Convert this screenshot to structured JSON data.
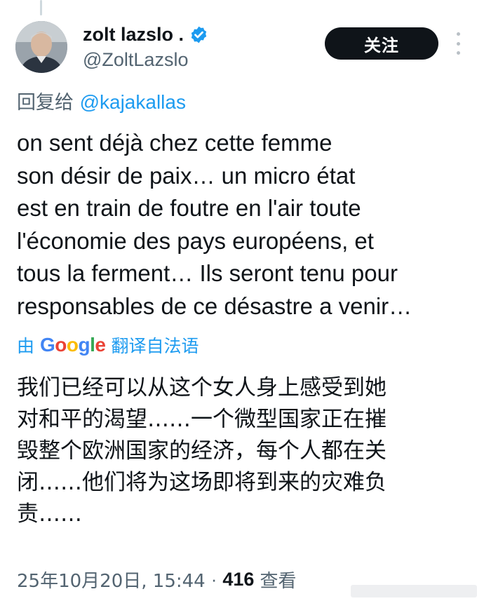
{
  "author": {
    "display_name": "zolt lazslo .",
    "handle": "@ZoltLazslo",
    "verified": true,
    "avatar": "avatar-photo"
  },
  "actions": {
    "follow_label": "关注",
    "more_icon": "more-vertical-icon"
  },
  "reply": {
    "prefix": "回复给",
    "mention": "@kajakallas"
  },
  "tweet": {
    "lines": [
      "on sent déjà chez cette femme",
      "son désir de paix… un micro état",
      "est en train de foutre en l'air toute",
      "l'économie des pays européens, et",
      "tous la ferment… Ils seront tenu pour",
      "responsables de ce désastre a venir…"
    ]
  },
  "translation": {
    "prefix": "由",
    "provider": "Google",
    "suffix": "翻译自法语",
    "lines": [
      "我们已经可以从这个女人身上感受到她",
      "对和平的渴望……一个微型国家正在摧",
      "毁整个欧洲国家的经济，每个人都在关",
      "闭……他们将为这场即将到来的灾难负",
      "责……"
    ]
  },
  "meta": {
    "date": "25年10月20日, 15:44",
    "separator": "·",
    "views": "416",
    "views_label": "查看"
  },
  "colors": {
    "text": "#0f1419",
    "secondary": "#536471",
    "link": "#1d9bf0",
    "verified": "#1d9bf0",
    "follow_bg": "#0f1419"
  }
}
